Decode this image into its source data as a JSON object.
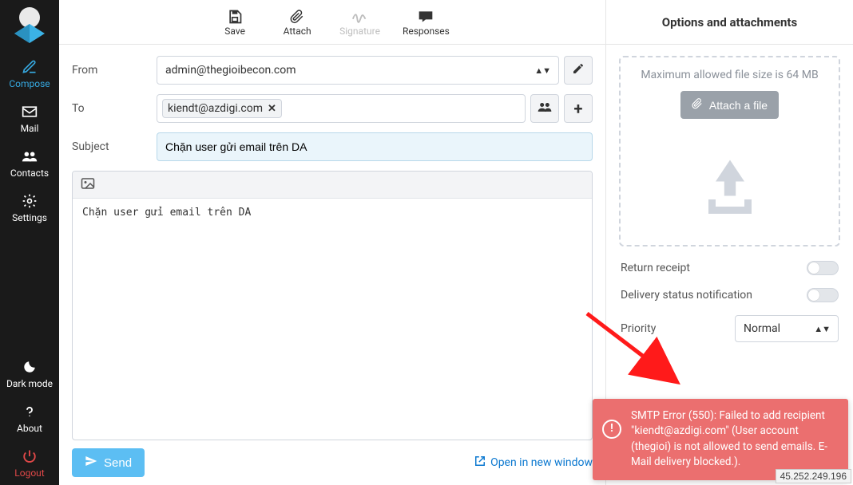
{
  "sidebar": {
    "items": [
      {
        "key": "compose",
        "label": "Compose"
      },
      {
        "key": "mail",
        "label": "Mail"
      },
      {
        "key": "contacts",
        "label": "Contacts"
      },
      {
        "key": "settings",
        "label": "Settings"
      }
    ],
    "bottom": [
      {
        "key": "darkmode",
        "label": "Dark mode"
      },
      {
        "key": "about",
        "label": "About"
      },
      {
        "key": "logout",
        "label": "Logout"
      }
    ]
  },
  "toolbar": {
    "save": "Save",
    "attach": "Attach",
    "signature": "Signature",
    "responses": "Responses"
  },
  "compose": {
    "from_label": "From",
    "from_value": "admin@thegioibecon.com",
    "to_label": "To",
    "to_chip": "kiendt@azdigi.com",
    "subject_label": "Subject",
    "subject_value": "Chặn user gửi email trên DA",
    "body": "Chặn user gửi email trên DA",
    "send": "Send",
    "open_new": "Open in new window"
  },
  "right": {
    "title": "Options and attachments",
    "max_size": "Maximum allowed file size is 64 MB",
    "attach_btn": "Attach a file",
    "return_receipt": "Return receipt",
    "delivery_status": "Delivery status notification",
    "priority_label": "Priority",
    "priority_value": "Normal"
  },
  "toast": {
    "text": "SMTP Error (550): Failed to add recipient \"kiendt@azdigi.com\" (User account (thegioi) is not allowed to send emails. E-Mail delivery blocked.)."
  },
  "ip": "45.252.249.196"
}
